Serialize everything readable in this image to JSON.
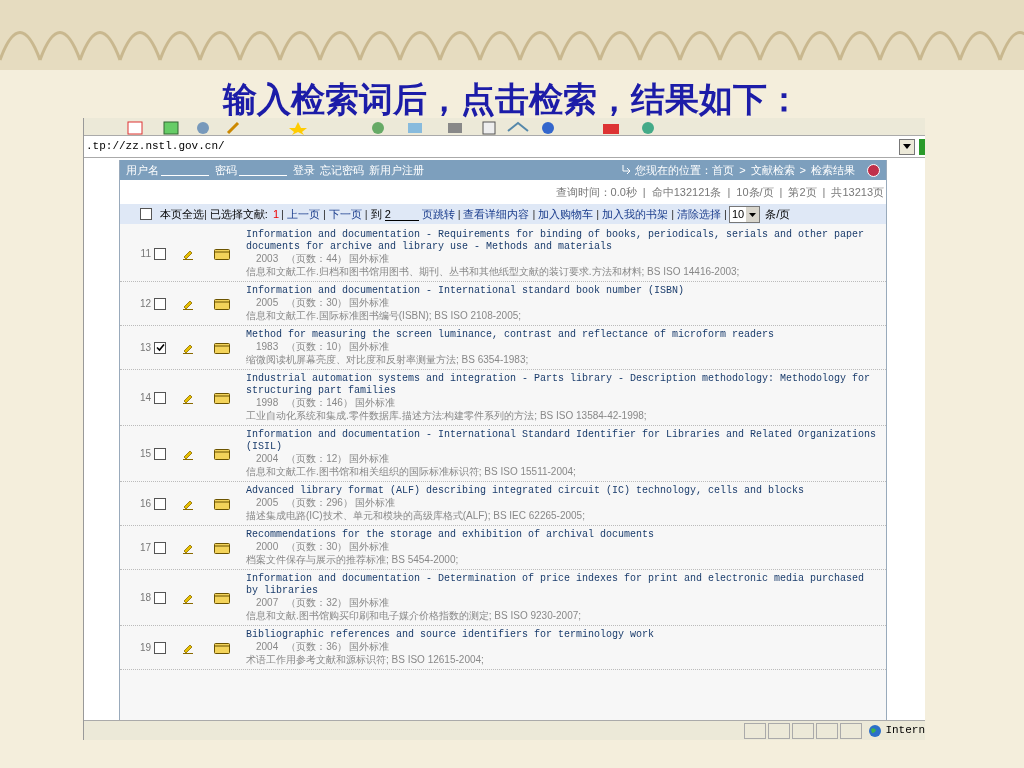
{
  "slide_title": "输入检索词后，点击检索，结果如下：",
  "browser": {
    "address": ".tp://zz.nstl.gov.cn/",
    "status_zone": "Intern"
  },
  "header": {
    "fields": [
      {
        "label": "用户名"
      },
      {
        "label": "密码"
      }
    ],
    "links": [
      "登录",
      "忘记密码",
      "新用户注册"
    ],
    "location_label": "您现在的位置：",
    "separator": ">",
    "crumbs": [
      "首页",
      "文献检索",
      "检索结果"
    ]
  },
  "info": {
    "separator": "|",
    "items": [
      "查询时间：0.0秒",
      "命中132121条",
      "10条/页",
      "第2页",
      "共13213页"
    ]
  },
  "selection_bar": {
    "select_all": {
      "label": "本页全选",
      "checked": false
    },
    "items": [
      {
        "kind": "sep",
        "text": "|"
      },
      {
        "kind": "label",
        "text": "已选择文献:"
      },
      {
        "kind": "count",
        "text": "1"
      },
      {
        "kind": "sep",
        "text": "|"
      },
      {
        "kind": "link",
        "text": "上一页"
      },
      {
        "kind": "sep",
        "text": "|"
      },
      {
        "kind": "link",
        "text": "下一页"
      },
      {
        "kind": "sep",
        "text": "|"
      },
      {
        "kind": "label",
        "text": "到"
      },
      {
        "kind": "input",
        "text": "2"
      },
      {
        "kind": "link",
        "text": "页跳转"
      },
      {
        "kind": "sep",
        "text": "|"
      },
      {
        "kind": "link",
        "text": "查看详细内容"
      },
      {
        "kind": "sep",
        "text": "|"
      },
      {
        "kind": "link",
        "text": "加入购物车"
      },
      {
        "kind": "sep",
        "text": "|"
      },
      {
        "kind": "link",
        "text": "加入我的书架"
      },
      {
        "kind": "sep",
        "text": "|"
      },
      {
        "kind": "link",
        "text": "清除选择"
      },
      {
        "kind": "sep",
        "text": "|"
      },
      {
        "kind": "select",
        "text": "10"
      },
      {
        "kind": "label",
        "text": "条/页"
      }
    ]
  },
  "results": [
    {
      "number": "11",
      "checked": false,
      "title": "Information and documentation - Requirements for binding of books, periodicals, serials and other paper documents for archive and library use - Methods and materials",
      "year": "2003",
      "pages": "（页数：44）",
      "category": "国外标准",
      "description": "信息和文献工作.归档和图书馆用图书、期刊、丛书和其他纸型文献的装订要求.方法和材料; BS ISO 14416-2003;"
    },
    {
      "number": "12",
      "checked": false,
      "title": "Information and documentation - International standard book number (ISBN)",
      "year": "2005",
      "pages": "（页数：30）",
      "category": "国外标准",
      "description": "信息和文献工作.国际标准图书编号(ISBN); BS ISO 2108-2005;"
    },
    {
      "number": "13",
      "checked": true,
      "title": "Method for measuring the screen luminance, contrast and reflectance of microform readers",
      "year": "1983",
      "pages": "（页数：10）",
      "category": "国外标准",
      "description": "缩微阅读机屏幕亮度、对比度和反射率测量方法; BS 6354-1983;"
    },
    {
      "number": "14",
      "checked": false,
      "title": "Industrial automation systems and integration - Parts library - Description methodology: Methodology for structuring part families",
      "year": "1998",
      "pages": "（页数：146）",
      "category": "国外标准",
      "description": "工业自动化系统和集成.零件数据库.描述方法:构建零件系列的方法; BS ISO 13584-42-1998;"
    },
    {
      "number": "15",
      "checked": false,
      "title": "Information and documentation - International Standard Identifier for Libraries and Related Organizations (ISIL)",
      "year": "2004",
      "pages": "（页数：12）",
      "category": "国外标准",
      "description": "信息和文献工作.图书馆和相关组织的国际标准标识符; BS ISO 15511-2004;"
    },
    {
      "number": "16",
      "checked": false,
      "title": "Advanced library format (ALF) describing integrated circuit (IC) technology, cells and blocks",
      "year": "2005",
      "pages": "（页数：296）",
      "category": "国外标准",
      "description": "描述集成电路(IC)技术、单元和模块的高级库格式(ALF); BS IEC 62265-2005;"
    },
    {
      "number": "17",
      "checked": false,
      "title": "Recommendations for the storage and exhibition of archival documents",
      "year": "2000",
      "pages": "（页数：30）",
      "category": "国外标准",
      "description": "档案文件保存与展示的推荐标准; BS 5454-2000;"
    },
    {
      "number": "18",
      "checked": false,
      "title": "Information and documentation - Determination of price indexes for print and electronic media purchased by libraries",
      "year": "2007",
      "pages": "（页数：32）",
      "category": "国外标准",
      "description": "信息和文献.图书馆购买印刷和电子媒介价格指数的测定; BS ISO 9230-2007;"
    },
    {
      "number": "19",
      "checked": false,
      "title": "Bibliographic references and source identifiers for terminology work",
      "year": "2004",
      "pages": "（页数：36）",
      "category": "国外标准",
      "description": "术语工作用参考文献和源标识符; BS ISO 12615-2004;"
    }
  ]
}
